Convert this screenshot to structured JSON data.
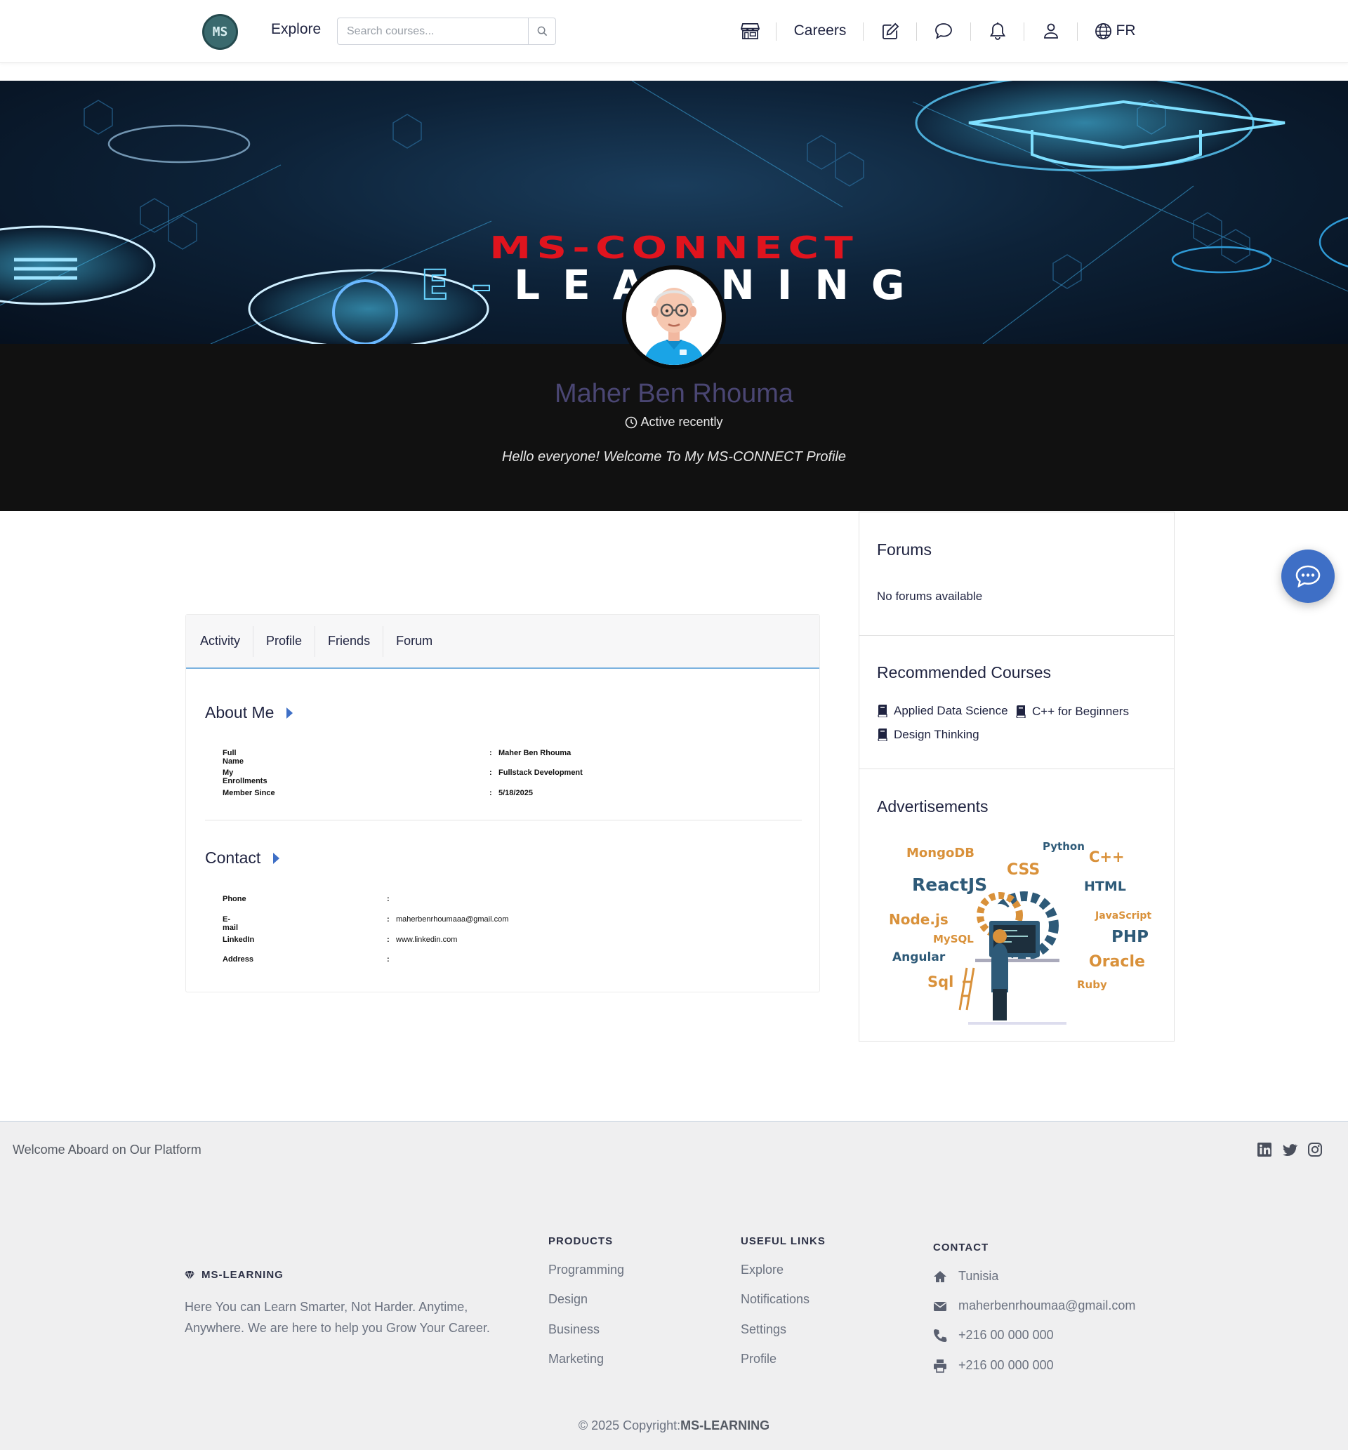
{
  "navbar": {
    "logo_text": "MS",
    "explore": "Explore",
    "search_placeholder": "Search courses...",
    "careers": "Careers",
    "language": "FR",
    "icons": [
      "store-icon",
      "edit-icon",
      "chat-icon",
      "bell-icon",
      "user-icon",
      "globe-icon"
    ]
  },
  "banner": {
    "title_prefix": "E–",
    "title_main": "LEARNING",
    "subtitle": "MS-CONNECT"
  },
  "profile": {
    "name": "Maher Ben Rhouma",
    "status": "Active recently",
    "bio": "Hello everyone! Welcome To My MS-CONNECT Profile"
  },
  "tabs": [
    "Activity",
    "Profile",
    "Friends",
    "Forum"
  ],
  "about": {
    "title": "About Me",
    "rows": [
      {
        "label": "Full Name",
        "value": "Maher Ben Rhouma"
      },
      {
        "label": "My Enrollments",
        "value": "Fullstack Development"
      },
      {
        "label": "Member Since",
        "value": "5/18/2025"
      }
    ]
  },
  "contact": {
    "title": "Contact",
    "rows": [
      {
        "label": "Phone",
        "value": ""
      },
      {
        "label": "E-mail",
        "value": "maherbenrhoumaaa@gmail.com"
      },
      {
        "label": "LinkedIn",
        "value": "www.linkedin.com"
      },
      {
        "label": "Address",
        "value": ""
      }
    ]
  },
  "sidebar": {
    "forums_title": "Forums",
    "forums_empty": "No forums available",
    "courses_title": "Recommended Courses",
    "courses": [
      "Applied Data Science",
      "C++ for Beginners",
      "Design Thinking"
    ],
    "ads_title": "Advertisements",
    "ad_words": [
      "MongoDB",
      "Python",
      "C++",
      "CSS",
      "ReactJS",
      "HTML",
      "Node.js",
      "JavaScript",
      "MySQL",
      "PHP",
      "Angular",
      "Oracle",
      "Sql",
      "Ruby"
    ]
  },
  "colors": {
    "accent": "#3e6fc6",
    "name": "#4a4673",
    "band": "#111111",
    "ad_orange": "#d9913a",
    "ad_teal": "#2e5a78"
  },
  "footer": {
    "welcome": "Welcome Aboard on Our Platform",
    "brand": "MS-LEARNING",
    "description": "Here You can Learn Smarter, Not Harder. Anytime, Anywhere. We are here to help you Grow Your Career.",
    "products_title": "PRODUCTS",
    "products": [
      "Programming",
      "Design",
      "Business",
      "Marketing"
    ],
    "links_title": "USEFUL LINKS",
    "links": [
      "Explore",
      "Notifications",
      "Settings",
      "Profile"
    ],
    "contact_title": "CONTACT",
    "contact": [
      "Tunisia",
      "maherbenrhoumaa@gmail.com",
      "+216 00 000 000",
      "+216 00 000 000"
    ],
    "copyright_prefix": "© 2025 Copyright:",
    "copyright_brand": "MS-LEARNING"
  }
}
